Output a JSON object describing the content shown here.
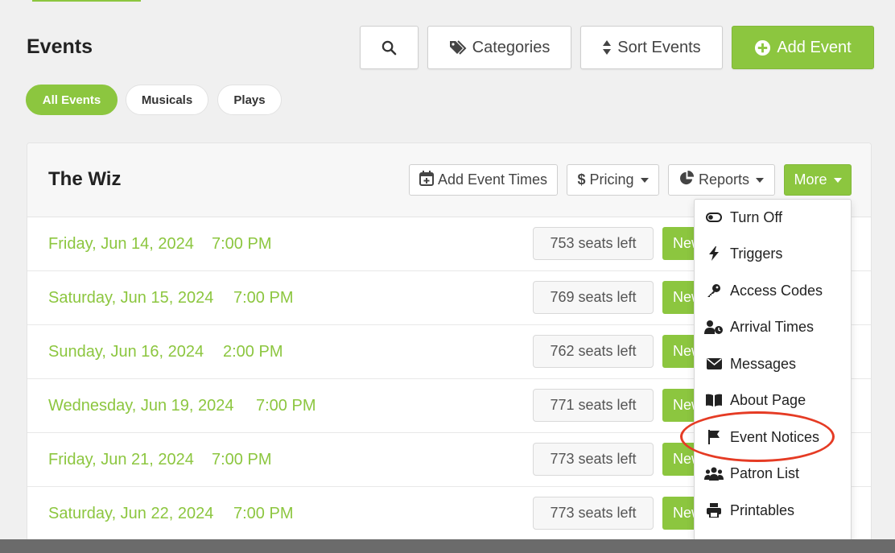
{
  "page": {
    "title": "Events"
  },
  "toolbar": {
    "categories_label": "Categories",
    "sort_label": "Sort Events",
    "add_event_label": "Add Event"
  },
  "filters": [
    {
      "label": "All Events",
      "active": true
    },
    {
      "label": "Musicals",
      "active": false
    },
    {
      "label": "Plays",
      "active": false
    }
  ],
  "event": {
    "title": "The Wiz",
    "actions": {
      "add_times_label": "Add Event Times",
      "pricing_label": "Pricing",
      "reports_label": "Reports",
      "more_label": "More"
    },
    "rows": [
      {
        "date": "Friday, Jun 14, 2024",
        "time": "7:00 PM",
        "seats": "753 seats left",
        "button": "New"
      },
      {
        "date": "Saturday, Jun 15, 2024",
        "time": "7:00 PM",
        "seats": "769 seats left",
        "button": "New"
      },
      {
        "date": "Sunday, Jun 16, 2024",
        "time": "2:00 PM",
        "seats": "762 seats left",
        "button": "New"
      },
      {
        "date": "Wednesday, Jun 19, 2024",
        "time": "7:00 PM",
        "seats": "771 seats left",
        "button": "New"
      },
      {
        "date": "Friday, Jun 21, 2024",
        "time": "7:00 PM",
        "seats": "773 seats left",
        "button": "New"
      },
      {
        "date": "Saturday, Jun 22, 2024",
        "time": "7:00 PM",
        "seats": "773 seats left",
        "button": "New"
      }
    ]
  },
  "more_menu": {
    "items": [
      {
        "label": "Turn Off",
        "icon": "toggle-icon"
      },
      {
        "label": "Triggers",
        "icon": "bolt-icon"
      },
      {
        "label": "Access Codes",
        "icon": "key-icon"
      },
      {
        "label": "Arrival Times",
        "icon": "user-clock-icon"
      },
      {
        "label": "Messages",
        "icon": "envelope-icon"
      },
      {
        "label": "About Page",
        "icon": "book-icon"
      },
      {
        "label": "Event Notices",
        "icon": "flag-icon"
      },
      {
        "label": "Patron List",
        "icon": "users-icon"
      },
      {
        "label": "Printables",
        "icon": "printer-icon"
      }
    ],
    "highlighted_item": "Event Notices"
  },
  "colors": {
    "accent_green": "#8cc63f",
    "highlight_red": "#e53b24"
  }
}
